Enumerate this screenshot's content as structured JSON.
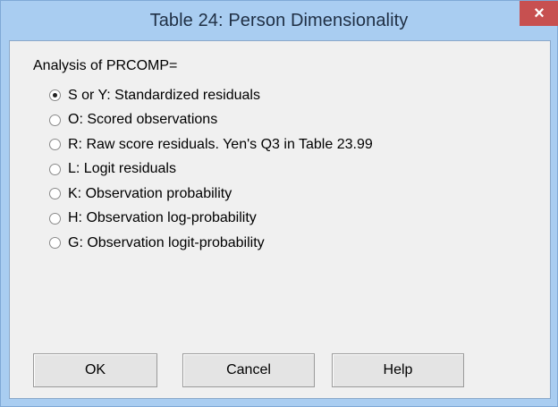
{
  "window": {
    "title": "Table 24: Person Dimensionality",
    "close_label": "×"
  },
  "form": {
    "group_label": "Analysis of PRCOMP=",
    "selected_index": 0,
    "options": [
      {
        "label": "S or Y: Standardized residuals",
        "checked": true
      },
      {
        "label": "O: Scored observations",
        "checked": false
      },
      {
        "label": "R: Raw score residuals. Yen's Q3 in Table 23.99",
        "checked": false
      },
      {
        "label": "L: Logit residuals",
        "checked": false
      },
      {
        "label": "K: Observation probability",
        "checked": false
      },
      {
        "label": "H: Observation log-probability",
        "checked": false
      },
      {
        "label": "G: Observation logit-probability",
        "checked": false
      }
    ]
  },
  "buttons": {
    "ok": "OK",
    "cancel": "Cancel",
    "help": "Help"
  },
  "colors": {
    "title_bar": "#a9cdf1",
    "close_button": "#c75050",
    "client_background": "#f0f0f0"
  }
}
